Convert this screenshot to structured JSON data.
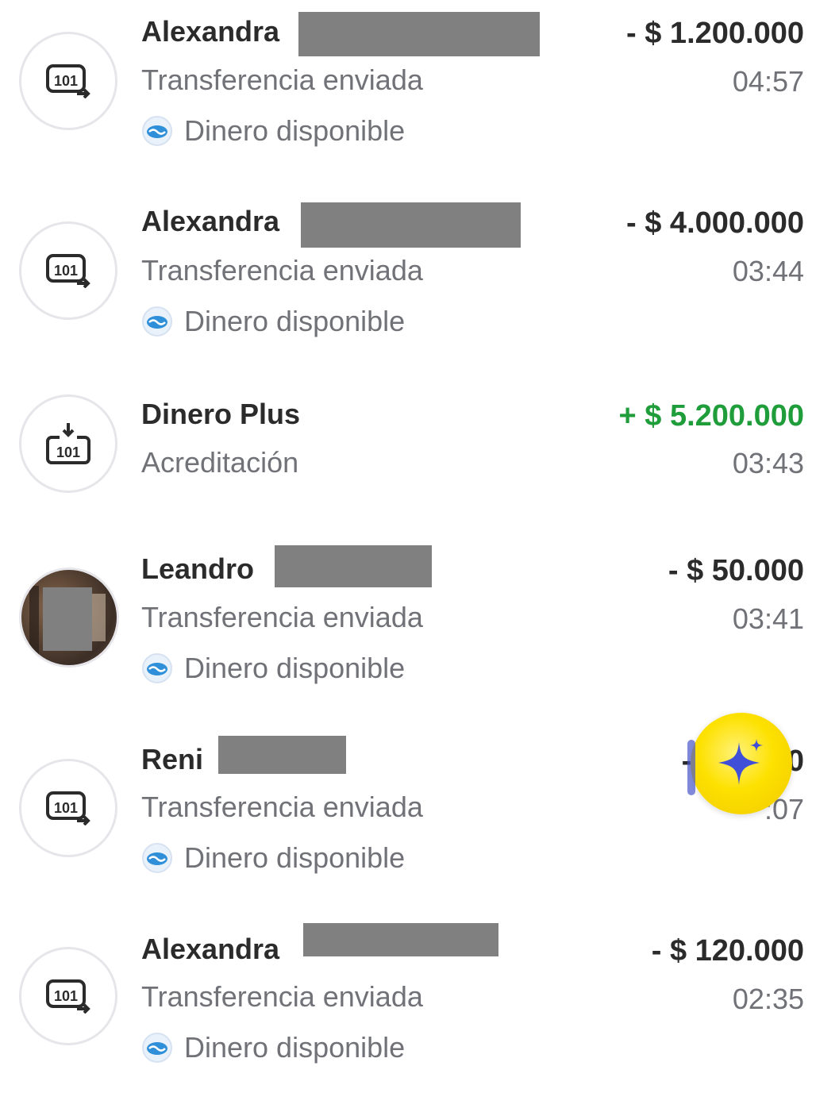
{
  "transactions": [
    {
      "name": "Alexandra",
      "description": "Transferencia enviada",
      "source": "Dinero disponible",
      "amount": "- $ 1.200.000",
      "time": "04:57",
      "icon": "transfer-out-icon"
    },
    {
      "name": "Alexandra",
      "description": "Transferencia enviada",
      "source": "Dinero disponible",
      "amount": "- $ 4.000.000",
      "time": "03:44",
      "icon": "transfer-out-icon"
    },
    {
      "name": "Dinero Plus",
      "description": "Acreditación",
      "source": "",
      "amount": "+ $ 5.200.000",
      "time": "03:43",
      "icon": "deposit-in-icon"
    },
    {
      "name": "Leandro",
      "description": "Transferencia enviada",
      "source": "Dinero disponible",
      "amount": "- $ 50.000",
      "time": "03:41",
      "icon": "avatar-photo"
    },
    {
      "name": "Reni",
      "description": "Transferencia enviada",
      "source": "Dinero disponible",
      "amount": "- $",
      "amount_tail": "0",
      "time": ":07",
      "icon": "transfer-out-icon"
    },
    {
      "name": "Alexandra",
      "description": "Transferencia enviada",
      "source": "Dinero disponible",
      "amount": "- $ 120.000",
      "time": "02:35",
      "icon": "transfer-out-icon"
    }
  ],
  "colors": {
    "positive_amount": "#1f9d3a",
    "primary_text": "#2b2b2b",
    "secondary_text": "#707278",
    "fab_yellow": "#fde100",
    "sparkle_blue": "#3f4fd8"
  },
  "fab": {
    "icon": "sparkle-icon"
  }
}
